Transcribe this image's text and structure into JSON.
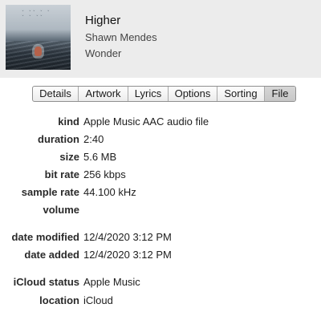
{
  "song": {
    "title": "Higher",
    "artist": "Shawn Mendes",
    "album": "Wonder"
  },
  "tabs": [
    {
      "label": "Details"
    },
    {
      "label": "Artwork"
    },
    {
      "label": "Lyrics"
    },
    {
      "label": "Options"
    },
    {
      "label": "Sorting"
    },
    {
      "label": "File",
      "active": true
    }
  ],
  "file_info": {
    "kind": {
      "label": "kind",
      "value": "Apple Music AAC audio file"
    },
    "duration": {
      "label": "duration",
      "value": "2:40"
    },
    "size": {
      "label": "size",
      "value": "5.6 MB"
    },
    "bit_rate": {
      "label": "bit rate",
      "value": "256 kbps"
    },
    "sample_rate": {
      "label": "sample rate",
      "value": "44.100 kHz"
    },
    "volume": {
      "label": "volume",
      "value": ""
    },
    "date_modified": {
      "label": "date modified",
      "value": "12/4/2020 3:12 PM"
    },
    "date_added": {
      "label": "date added",
      "value": "12/4/2020 3:12 PM"
    },
    "icloud_status": {
      "label": "iCloud status",
      "value": "Apple Music"
    },
    "location": {
      "label": "location",
      "value": "iCloud"
    }
  },
  "colors": {
    "header_background": "#ececec",
    "active_tab": "#c7c7c7"
  }
}
